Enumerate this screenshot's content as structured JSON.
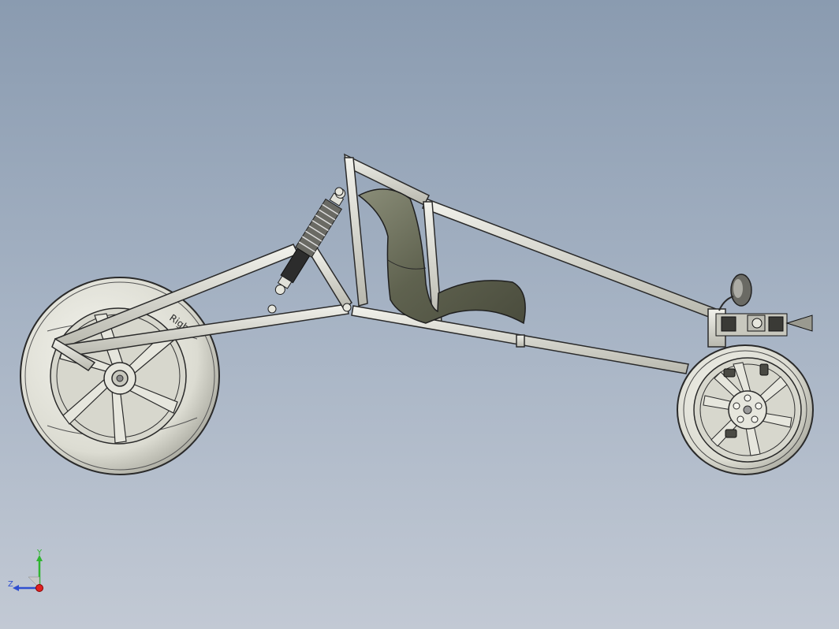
{
  "viewport": {
    "background_top": "#8a9bb0",
    "background_bottom": "#c2c9d4"
  },
  "model": {
    "tire_label": "Right",
    "color_body": "#e3e3dc",
    "color_edge": "#2a2a2a",
    "color_seat": "#6b6e5c"
  },
  "triad": {
    "y_label": "Y",
    "z_label": "Z",
    "y_color": "#2fb52f",
    "z_color": "#2f4fd0",
    "x_color": "#e02020"
  }
}
